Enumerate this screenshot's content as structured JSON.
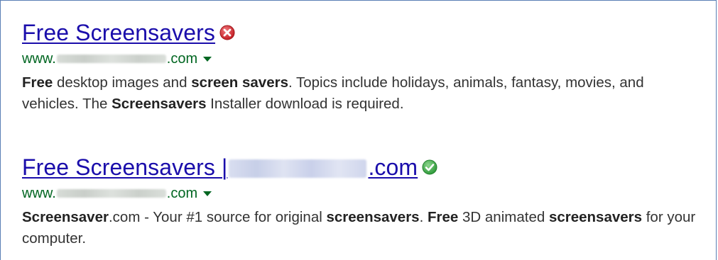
{
  "results": [
    {
      "title": "Free Screensavers",
      "title_domain_suffix": "",
      "url_prefix": "www.",
      "url_suffix": ".com",
      "status_icon": "red-x-icon",
      "status_color": "#d8272d",
      "snippet": [
        {
          "t": "Free",
          "b": true
        },
        {
          "t": " desktop images and ",
          "b": false
        },
        {
          "t": "screen savers",
          "b": true
        },
        {
          "t": ". Topics include holidays, animals, fantasy, movies, and vehicles. The ",
          "b": false
        },
        {
          "t": "Screensavers",
          "b": true
        },
        {
          "t": " Installer download is required.",
          "b": false
        }
      ]
    },
    {
      "title": "Free Screensavers |",
      "title_domain_suffix": ".com",
      "url_prefix": "www.",
      "url_suffix": ".com",
      "status_icon": "green-check-icon",
      "status_color": "#3aa745",
      "snippet": [
        {
          "t": "Screensaver",
          "b": true
        },
        {
          "t": ".com - Your #1 source for original ",
          "b": false
        },
        {
          "t": "screensavers",
          "b": true
        },
        {
          "t": ". ",
          "b": false
        },
        {
          "t": "Free",
          "b": true
        },
        {
          "t": " 3D animated ",
          "b": false
        },
        {
          "t": "screensavers",
          "b": true
        },
        {
          "t": " for your computer.",
          "b": false
        }
      ]
    }
  ],
  "colors": {
    "link": "#1a0dab",
    "url": "#006621",
    "frame": "#5a7fb5"
  }
}
